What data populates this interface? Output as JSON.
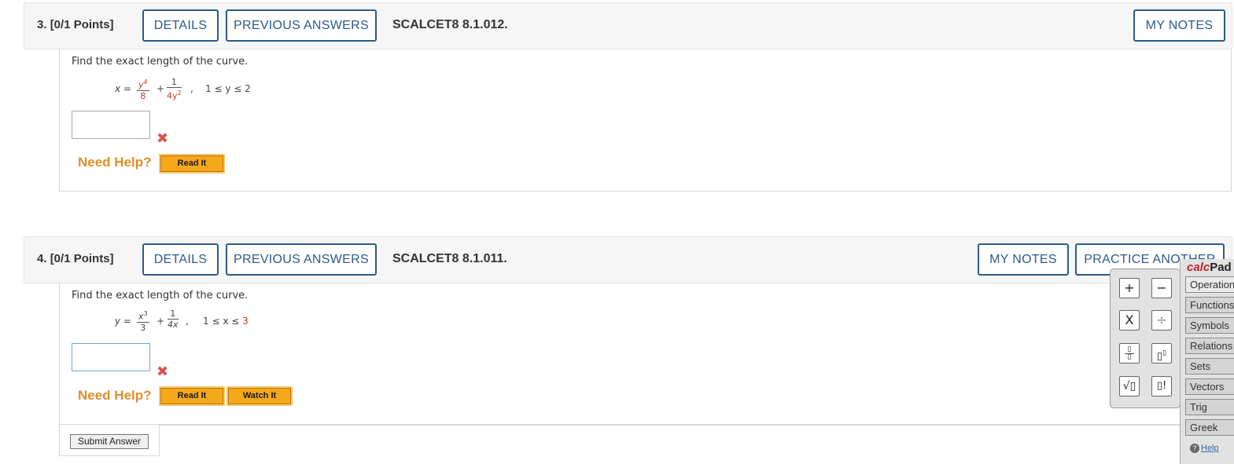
{
  "q3": {
    "number": "3.",
    "points": "[0/1 Points]",
    "details": "DETAILS",
    "previous": "PREVIOUS ANSWERS",
    "code": "SCALCET8 8.1.012.",
    "my_notes": "MY NOTES",
    "prompt": "Find the exact length of the curve.",
    "eq_lhs": "x =",
    "f1_num": "y",
    "f1_num_exp": "4",
    "f1_den": "8",
    "plus": "+",
    "f2_num": "1",
    "f2_den": "4y",
    "f2_den_exp": "2",
    "comma": ",",
    "range": "1 ≤ y ≤ 2",
    "need_help": "Need Help?",
    "read_it": "Read It"
  },
  "q4": {
    "number": "4.",
    "points": "[0/1 Points]",
    "details": "DETAILS",
    "previous": "PREVIOUS ANSWERS",
    "code": "SCALCET8 8.1.011.",
    "my_notes": "MY NOTES",
    "practice": "PRACTICE ANOTHER",
    "prompt": "Find the exact length of the curve.",
    "eq_lhs": "y =",
    "f1_num": "x",
    "f1_num_exp": "3",
    "f1_den": "3",
    "plus": "+",
    "f2_num": "1",
    "f2_den": "4x",
    "comma": ",",
    "range_prefix": "1 ≤ x ≤ ",
    "range_upper": "3",
    "need_help": "Need Help?",
    "read_it": "Read It",
    "watch_it": "Watch It",
    "submit": "Submit Answer"
  },
  "calcpad": {
    "title_calc": "calc",
    "title_pad": "Pad",
    "buttons": [
      "+",
      "−",
      "X",
      "÷",
      "▯/▯",
      "▯▯",
      "√▯",
      "▯!"
    ],
    "tabs": [
      "Operations",
      "Functions",
      "Symbols",
      "Relations",
      "Sets",
      "Vectors",
      "Trig",
      "Greek"
    ],
    "help": "Help"
  },
  "colors": {
    "header_bg": "#f6f6f6",
    "button_border": "#2d5a8c",
    "need_help": "#e08e2b",
    "help_button": "#f6a81b",
    "wrong_mark": "#d9534f",
    "calc_red": "#c1272d"
  },
  "icons": {
    "wrong": "x-mark-icon",
    "help": "question-circle-icon"
  }
}
